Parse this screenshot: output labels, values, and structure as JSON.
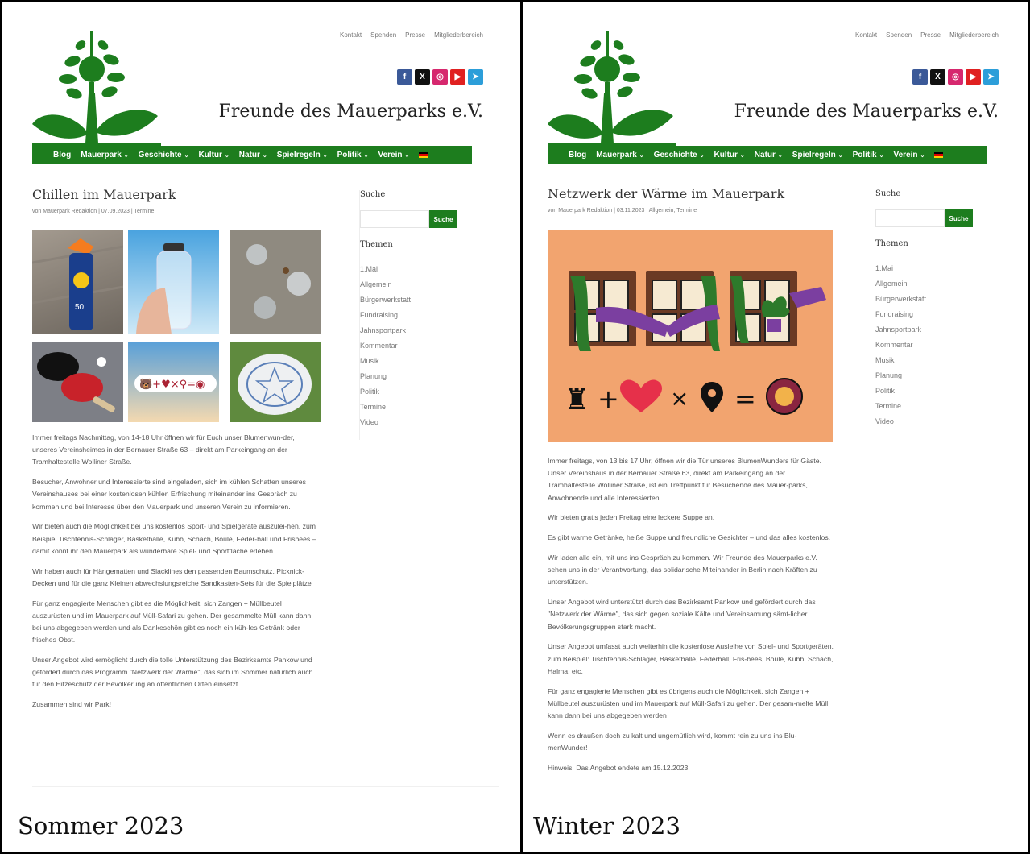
{
  "site": {
    "top_links": [
      "Kontakt",
      "Spenden",
      "Presse",
      "Mitgliederbereich"
    ],
    "title": "Freunde des Mauerparks e.V.",
    "social": [
      {
        "icon": "facebook-icon",
        "glyph": "f",
        "color": "#3b5998"
      },
      {
        "icon": "x-icon",
        "glyph": "X",
        "color": "#111111"
      },
      {
        "icon": "instagram-icon",
        "glyph": "◎",
        "color": "#d6286e"
      },
      {
        "icon": "youtube-icon",
        "glyph": "▶",
        "color": "#e02020"
      },
      {
        "icon": "telegram-icon",
        "glyph": "➤",
        "color": "#2c9ed9"
      }
    ],
    "nav": [
      {
        "label": "Blog",
        "chev": ""
      },
      {
        "label": "Mauerpark",
        "chev": "⌄"
      },
      {
        "label": "Geschichte",
        "chev": "⌄"
      },
      {
        "label": "Kultur",
        "chev": "⌄"
      },
      {
        "label": "Natur",
        "chev": "⌄"
      },
      {
        "label": "Spielregeln",
        "chev": "⌄"
      },
      {
        "label": "Politik",
        "chev": "⌄"
      },
      {
        "label": "Verein",
        "chev": "⌄"
      }
    ],
    "accent": "#1d7d1e",
    "sidebar": {
      "search_heading": "Suche",
      "search_button": "Suche",
      "topics_heading": "Themen",
      "topics": [
        "1.Mai",
        "Allgemein",
        "Bürgerwerkstatt",
        "Fundraising",
        "Jahnsportpark",
        "Kommentar",
        "Musik",
        "Planung",
        "Politik",
        "Termine",
        "Video"
      ]
    }
  },
  "left": {
    "label": "Sommer 2023",
    "post_title": "Chillen im Mauerpark",
    "meta": "von Mauerpark Redaktion | 07.09.2023 | Termine",
    "paragraphs": [
      "Immer freitags Nachmittag, von 14-18 Uhr öffnen wir für Euch unser Blumenwun-der, unseres Vereinsheimes in der Bernauer Straße 63 – direkt am Parkeingang an der Tramhaltestelle Wolliner Straße.",
      "Besucher, Anwohner und Interessierte sind eingeladen, sich im kühlen Schatten unseres Vereinshauses bei einer kostenlosen kühlen Erfrischung miteinander ins Gespräch zu kommen und bei Interesse über den Mauerpark und unseren Verein zu informieren.",
      "Wir bieten auch die Möglichkeit bei uns kostenlos Sport- und Spielgeräte auszulei-hen, zum Beispiel Tischtennis-Schläger, Basketbälle, Kubb, Schach, Boule, Feder-ball und Frisbees – damit könnt ihr den Mauerpark als wunderbare Spiel- und Sportfläche erleben.",
      "Wir haben auch für Hängematten und Slacklines den passenden Baumschutz, Picknick-Decken und für die ganz Kleinen abwechslungsreiche Sandkasten-Sets für die Spielplätze",
      "Für ganz engagierte Menschen gibt es die Möglichkeit, sich Zangen + Müllbeutel auszurüsten und im Mauerpark auf Müll-Safari zu gehen. Der gesammelte Müll kann dann bei uns abgegeben werden und als Dankeschön gibt es noch ein küh-les Getränk oder frisches Obst.",
      "Unser Angebot wird ermöglicht durch die tolle Unterstützung des Bezirksamts Pankow und gefördert durch das Programm \"Netzwerk der Wärme\", das sich im Sommer natürlich auch für den Hitzeschutz der Bevölkerung an öffentlichen Orten einsetzt.",
      "Zusammen sind wir Park!"
    ]
  },
  "right": {
    "label": "Winter 2023",
    "post_title": "Netzwerk der Wärme im Mauerpark",
    "meta": "von Mauerpark Redaktion | 03.11.2023 | Allgemein, Termine",
    "paragraphs": [
      "Immer freitags, von 13 bis 17 Uhr, öffnen wir die Tür unseres BlumenWunders für Gäste. Unser Vereinshaus in der Bernauer Straße 63, direkt am Parkeingang an der Tramhaltestelle Wolliner Straße, ist ein Treffpunkt für Besuchende des Mauer-parks, Anwohnende und alle Interessierten.",
      "Wir bieten gratis jeden Freitag eine leckere Suppe an.",
      "Es gibt warme Getränke, heiße Suppe und freundliche Gesichter – und das alles kostenlos.",
      "Wir laden alle ein, mit uns ins Gespräch zu kommen. Wir Freunde des Mauerparks e.V. sehen uns in der Verantwortung, das solidarische Miteinander in Berlin nach Kräften zu unterstützen.",
      "Unser Angebot wird unterstützt durch das Bezirksamt Pankow und gefördert durch das \"Netzwerk der Wärme\", das sich gegen soziale Kälte und Vereinsamung sämt-licher Bevölkerungsgruppen stark macht.",
      "Unser Angebot umfasst auch weiterhin die kostenlose Ausleihe von Spiel- und Sportgeräten, zum Beispiel: Tischtennis-Schläger, Basketbälle, Federball, Fris-bees, Boule, Kubb, Schach, Halma, etc.",
      "Für ganz engagierte Menschen gibt es übrigens auch die Möglichkeit, sich Zangen + Müllbeutel auszurüsten und im Mauerpark auf Müll-Safari zu gehen. Der gesam-melte Müll kann dann bei uns abgegeben werden",
      "Wenn es draußen doch zu kalt und ungemütlich wird, kommt rein zu uns ins Blu-menWunder!",
      "Hinweis: Das Angebot endete am 15.12.2023"
    ]
  }
}
